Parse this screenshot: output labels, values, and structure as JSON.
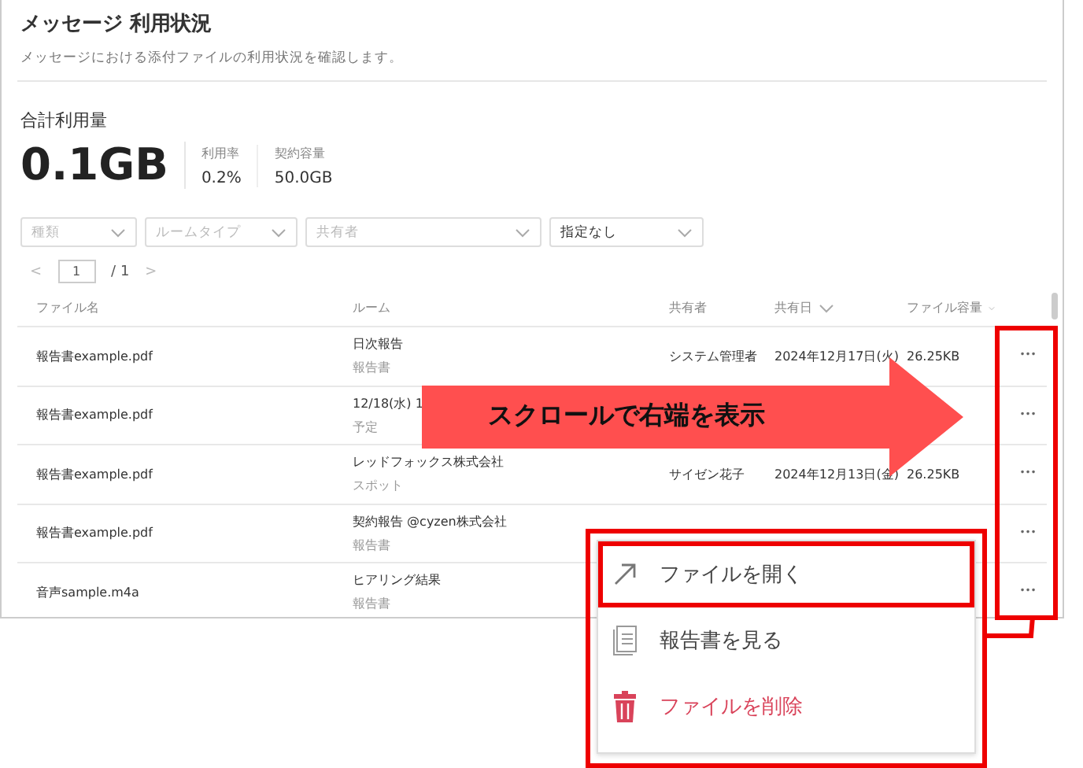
{
  "page": {
    "title": "メッセージ 利用状況",
    "subtitle": "メッセージにおける添付ファイルの利用状況を確認します。"
  },
  "usage": {
    "label": "合計利用量",
    "total": "0.1GB",
    "stats": [
      {
        "label": "利用率",
        "value": "0.2%"
      },
      {
        "label": "契約容量",
        "value": "50.0GB"
      }
    ]
  },
  "filters": [
    {
      "placeholder": "種類"
    },
    {
      "placeholder": "ルームタイプ"
    },
    {
      "placeholder": "共有者"
    },
    {
      "value": "指定なし"
    }
  ],
  "pager": {
    "prev": "<",
    "page": "1",
    "total": "/ 1",
    "next": ">"
  },
  "table": {
    "columns": [
      {
        "label": "ファイル名",
        "sortable": false
      },
      {
        "label": "ルーム",
        "sortable": false
      },
      {
        "label": "共有者",
        "sortable": false
      },
      {
        "label": "共有日",
        "sortable": true
      },
      {
        "label": "ファイル容量",
        "sortable": true
      }
    ],
    "rows": [
      {
        "file": "報告書example.pdf",
        "room": "日次報告",
        "room_type": "報告書",
        "sharer": "システム管理者",
        "date": "2024年12月17日(火)",
        "size": "26.25KB",
        "more": "•••"
      },
      {
        "file": "報告書example.pdf",
        "room": "12/18(水) 1",
        "room_type": "予定",
        "more": "•••"
      },
      {
        "file": "報告書example.pdf",
        "room": "レッドフォックス株式会社",
        "room_type": "スポット",
        "sharer": "サイゼン花子",
        "date": "2024年12月13日(金)",
        "size": "26.25KB",
        "more": "•••"
      },
      {
        "file": "報告書example.pdf",
        "room": "契約報告 @cyzen株式会社",
        "room_type": "報告書",
        "more": "•••"
      },
      {
        "file": "音声sample.m4a",
        "room": "ヒアリング結果",
        "room_type": "報告書",
        "more": "•••"
      }
    ]
  },
  "context_menu": {
    "items": [
      {
        "kind": "open",
        "label": "ファイルを開く",
        "highlighted": true
      },
      {
        "kind": "view",
        "label": "報告書を見る",
        "highlighted": false
      },
      {
        "kind": "delete",
        "label": "ファイルを削除",
        "highlighted": false
      }
    ]
  },
  "annotation": {
    "arrow_label": "スクロールで右端を表示"
  }
}
